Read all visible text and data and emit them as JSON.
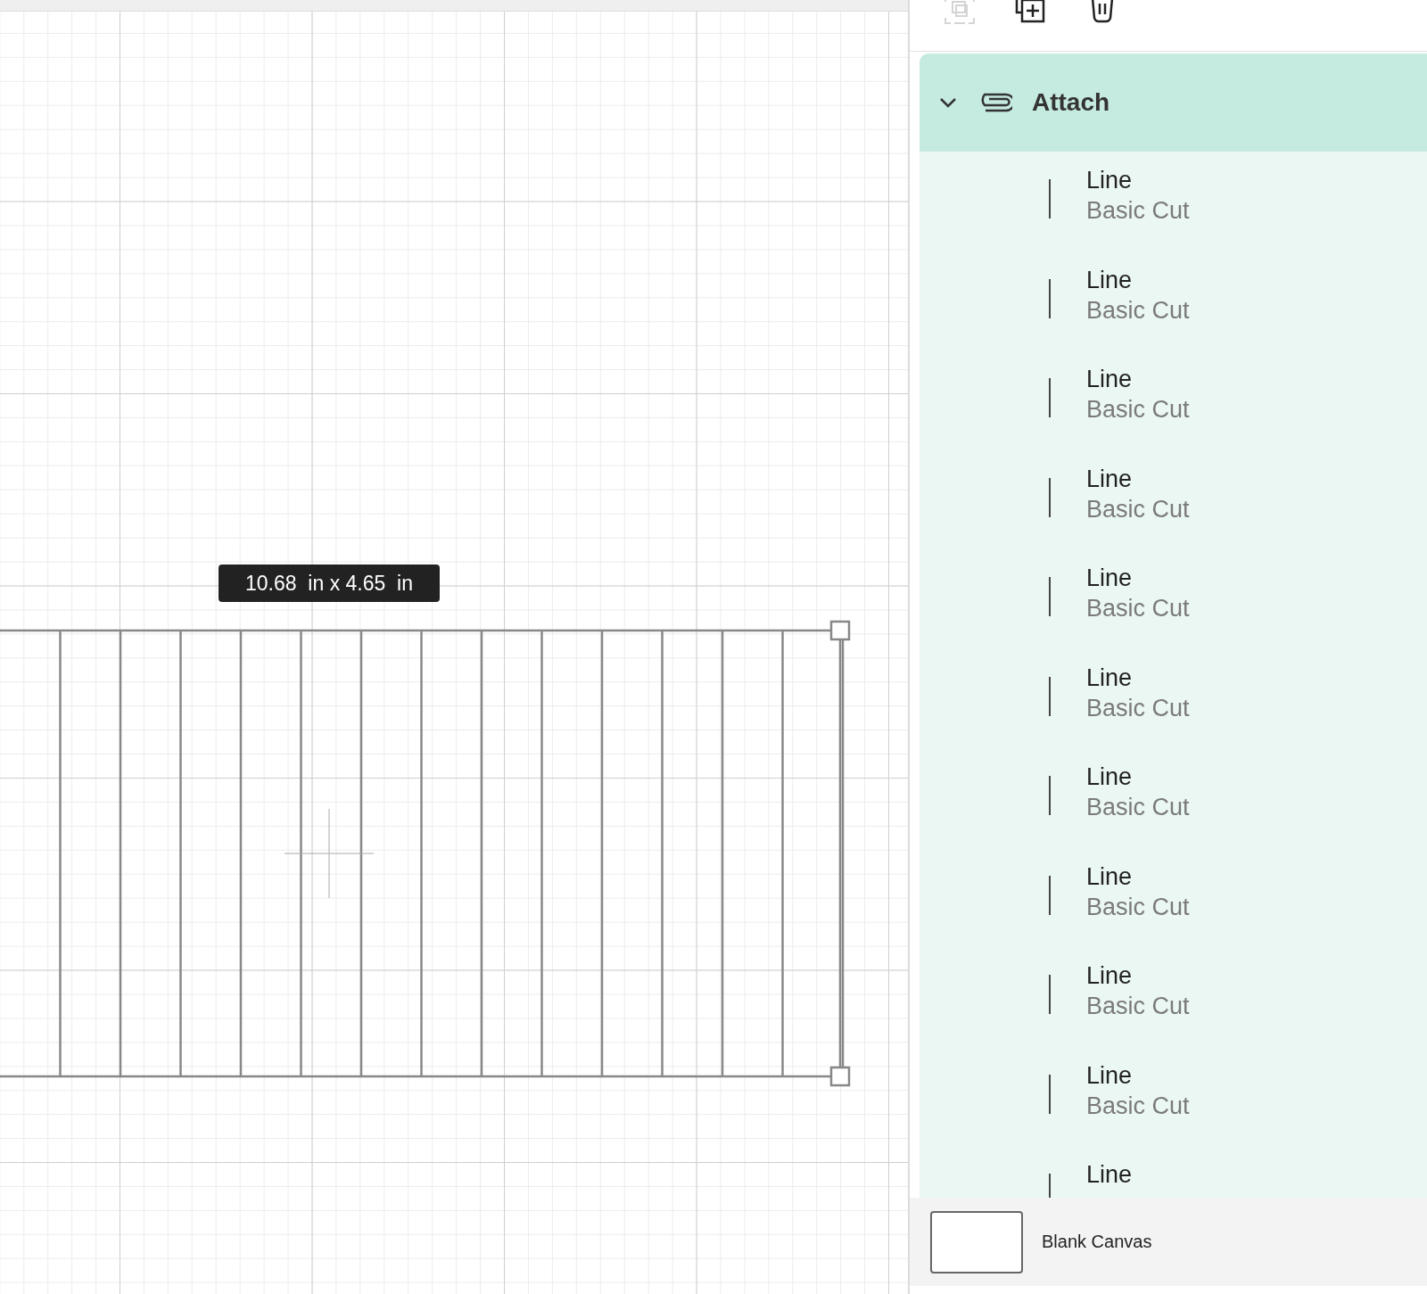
{
  "canvas": {
    "size_label": "10.68  in x 4.65  in"
  },
  "toolbar": [
    {
      "kind": "group",
      "disabled": true
    },
    {
      "kind": "duplicate",
      "disabled": false
    },
    {
      "kind": "delete",
      "disabled": false
    }
  ],
  "layers": {
    "group": {
      "label": "Attach",
      "expanded": true
    },
    "items": [
      {
        "name": "Line",
        "operation": "Basic Cut"
      },
      {
        "name": "Line",
        "operation": "Basic Cut"
      },
      {
        "name": "Line",
        "operation": "Basic Cut"
      },
      {
        "name": "Line",
        "operation": "Basic Cut"
      },
      {
        "name": "Line",
        "operation": "Basic Cut"
      },
      {
        "name": "Line",
        "operation": "Basic Cut"
      },
      {
        "name": "Line",
        "operation": "Basic Cut"
      },
      {
        "name": "Line",
        "operation": "Basic Cut"
      },
      {
        "name": "Line",
        "operation": "Basic Cut"
      },
      {
        "name": "Line",
        "operation": "Basic Cut"
      },
      {
        "name": "Line"
      }
    ]
  },
  "canvas_footer": {
    "label": "Blank Canvas"
  }
}
